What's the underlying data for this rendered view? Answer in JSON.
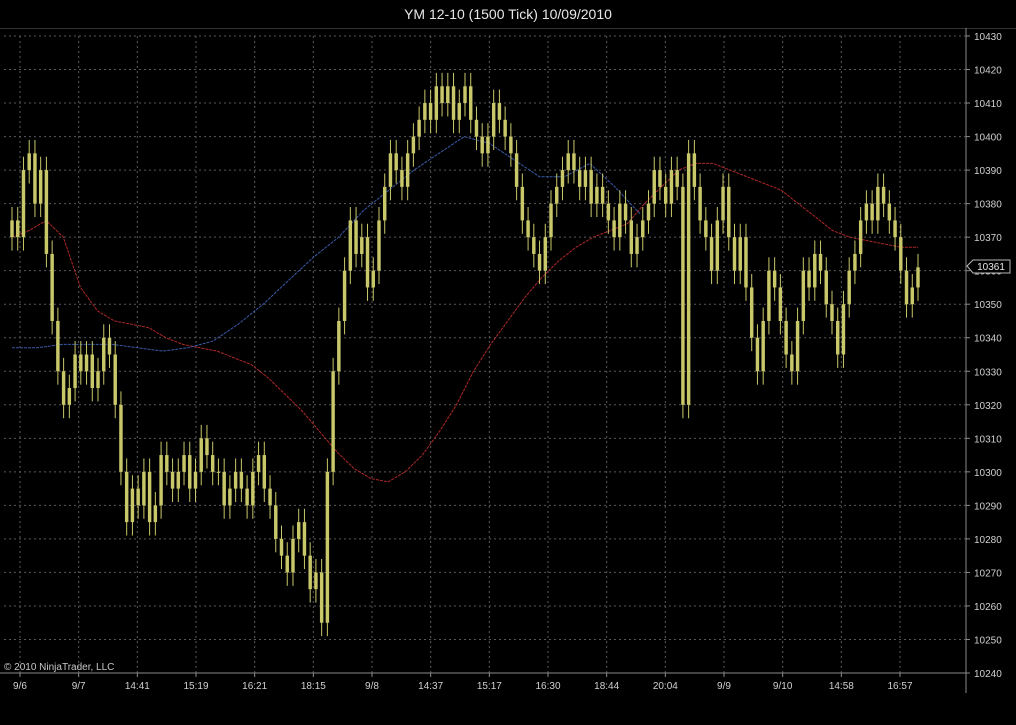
{
  "window": {
    "title": "YM 12-10 (1500 Tick)  10/09/2010",
    "copyright": "© 2010 NinjaTrader, LLC"
  },
  "colors": {
    "background": "#000000",
    "grid": "#5a5a5a",
    "candle": "#c8c86a",
    "ma_red": "#b02828",
    "ma_blue": "#3a5aa8",
    "axis_text": "#d0d0d0"
  },
  "chart_data": {
    "type": "candlestick",
    "title": "YM 12-10 (1500 Tick)  10/09/2010",
    "ylim": [
      10240,
      10430
    ],
    "y_ticks": [
      10240,
      10250,
      10260,
      10270,
      10280,
      10290,
      10300,
      10310,
      10320,
      10330,
      10340,
      10350,
      10360,
      10370,
      10380,
      10390,
      10400,
      10410,
      10420,
      10430
    ],
    "x_tick_labels": [
      "9/6",
      "9/7",
      "14:41",
      "15:19",
      "16:21",
      "18:15",
      "9/8",
      "14:37",
      "15:17",
      "16:30",
      "18:44",
      "20:04",
      "9/9",
      "9/10",
      "14:58",
      "16:57"
    ],
    "last_price": 10361,
    "grid": true,
    "close_series": [
      10375,
      10370,
      10390,
      10395,
      10380,
      10390,
      10365,
      10345,
      10330,
      10320,
      10325,
      10335,
      10330,
      10335,
      10325,
      10330,
      10340,
      10335,
      10320,
      10300,
      10285,
      10295,
      10290,
      10300,
      10285,
      10290,
      10305,
      10300,
      10295,
      10300,
      10305,
      10295,
      10300,
      10310,
      10305,
      10300,
      10300,
      10290,
      10295,
      10300,
      10295,
      10290,
      10300,
      10305,
      10295,
      10290,
      10280,
      10275,
      10270,
      10280,
      10285,
      10275,
      10265,
      10270,
      10255,
      10300,
      10330,
      10345,
      10360,
      10375,
      10365,
      10370,
      10355,
      10360,
      10375,
      10385,
      10395,
      10390,
      10385,
      10395,
      10400,
      10405,
      10410,
      10405,
      10415,
      10410,
      10415,
      10405,
      10410,
      10415,
      10405,
      10400,
      10395,
      10400,
      10410,
      10405,
      10400,
      10395,
      10385,
      10375,
      10370,
      10365,
      10360,
      10370,
      10380,
      10385,
      10390,
      10395,
      10390,
      10385,
      10390,
      10380,
      10385,
      10380,
      10375,
      10370,
      10380,
      10375,
      10365,
      10370,
      10375,
      10380,
      10390,
      10385,
      10380,
      10390,
      10385,
      10320,
      10395,
      10385,
      10375,
      10370,
      10360,
      10375,
      10385,
      10370,
      10360,
      10370,
      10355,
      10340,
      10330,
      10345,
      10360,
      10355,
      10345,
      10335,
      10330,
      10345,
      10360,
      10355,
      10365,
      10360,
      10350,
      10345,
      10335,
      10350,
      10360,
      10365,
      10375,
      10380,
      10375,
      10385,
      10380,
      10375,
      10370,
      10360,
      10350,
      10355,
      10361
    ],
    "series": [
      {
        "values": [
          10370,
          10372,
          10375,
          10370,
          10355,
          10348,
          10345,
          10344,
          10343,
          10340,
          10338,
          10337,
          10336,
          10334,
          10332,
          10328,
          10323,
          10318,
          10312,
          10306,
          10301,
          10298,
          10297,
          10300,
          10305,
          10312,
          10320,
          10330,
          10338,
          10345,
          10352,
          10358,
          10363,
          10367,
          10370,
          10372,
          10374,
          10380,
          10385,
          10390,
          10392,
          10392,
          10390,
          10388,
          10386,
          10384,
          10380,
          10376,
          10372,
          10370,
          10369,
          10368,
          10367,
          10367
        ]
      },
      {
        "values": [
          10337,
          10337,
          10338,
          10338,
          10338,
          10337,
          10336,
          10337,
          10339,
          10344,
          10350,
          10357,
          10364,
          10370,
          10378,
          10384,
          10390,
          10395,
          10400,
          10398,
          10393,
          10388,
          10388,
          10392,
          10385,
          10377
        ]
      }
    ]
  }
}
